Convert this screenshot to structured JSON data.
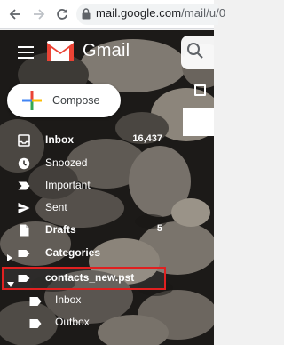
{
  "browser": {
    "url_host": "mail.google.com",
    "url_path": "/mail/u/0"
  },
  "header": {
    "app_name": "Gmail"
  },
  "compose": {
    "label": "Compose"
  },
  "nav": {
    "inbox": {
      "label": "Inbox",
      "count": "16,437",
      "icon": "inbox-icon"
    },
    "snoozed": {
      "label": "Snoozed",
      "icon": "clock-icon"
    },
    "important": {
      "label": "Important",
      "icon": "important-label-icon"
    },
    "sent": {
      "label": "Sent",
      "icon": "send-icon"
    },
    "drafts": {
      "label": "Drafts",
      "count": "5",
      "icon": "draft-icon"
    },
    "categories": {
      "label": "Categories",
      "icon": "label-icon"
    },
    "contacts": {
      "label": "contacts_new.pst",
      "icon": "label-icon"
    },
    "sub_inbox": {
      "label": "Inbox",
      "icon": "label-icon"
    },
    "sub_outbox": {
      "label": "Outbox",
      "icon": "label-icon"
    }
  },
  "colors": {
    "highlight_border": "#e02020",
    "gmail_red": "#ea4335",
    "compose_text": "#3c4043"
  }
}
